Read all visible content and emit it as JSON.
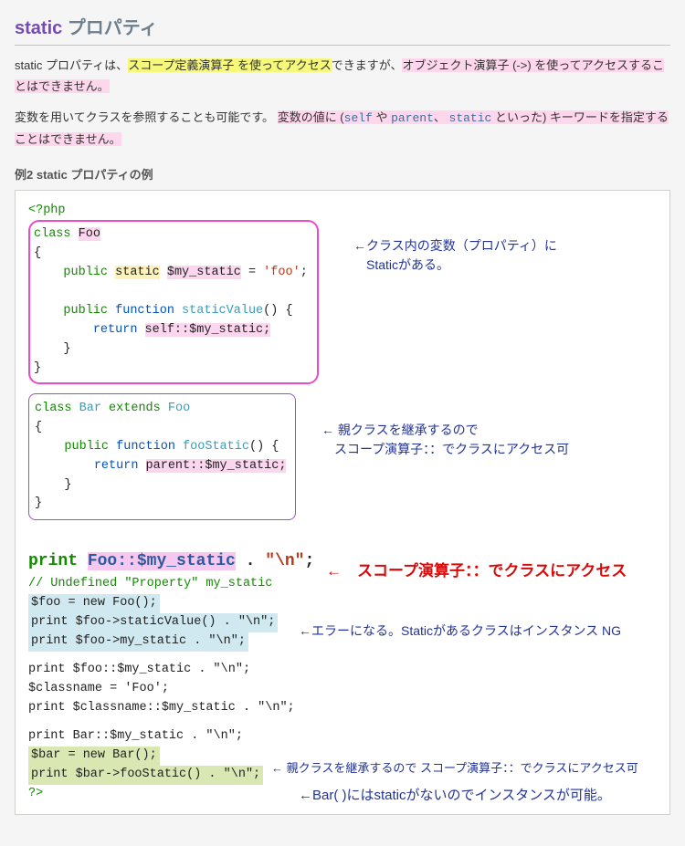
{
  "title_keyword": "static",
  "title_rest": " プロパティ",
  "para1_a": "static プロパティは、",
  "para1_hl_a": "スコープ定義演算子 を使ってアクセス",
  "para1_b": "できますが、",
  "para1_hl_b": "オブジェクト演算子 (->) を使ってアクセスすることはできません。",
  "para2_a": "変数を用いてクラスを参照することも可能です。",
  "para2_hl": "変数の値に (",
  "para2_mono1": "self",
  "para2_hl_mid1": " や ",
  "para2_mono2": "parent",
  "para2_hl_mid2": "、 ",
  "para2_mono3": "static",
  "para2_hl_tail": " といった) キーワードを指定することはできません。",
  "ex_title": "例2 static プロパティの例",
  "code_open": "<?php",
  "foo_line1": "class",
  "foo_name": "Foo",
  "foo_brace_open": "{",
  "foo_pub": "public",
  "foo_static": "static",
  "foo_var": "$my_static",
  "foo_assign": " = ",
  "foo_str": "'foo'",
  "foo_semi": ";",
  "foo_func_pub": "public",
  "foo_func_kw": "function",
  "foo_func_name": "staticValue",
  "foo_func_paren": "() {",
  "foo_return": "return",
  "foo_return_val": "self::$my_static;",
  "foo_brace_close": "}",
  "foo_brace_close2": "}",
  "bar_line1": "class",
  "bar_name": "Bar",
  "bar_ext": "extends",
  "bar_parent": "Foo",
  "bar_brace_open": "{",
  "bar_func_pub": "public",
  "bar_func_kw": "function",
  "bar_func_name": "fooStatic",
  "bar_func_paren": "() {",
  "bar_return": "return",
  "bar_return_val": "parent::$my_static;",
  "bar_brace_close": "}",
  "bar_brace_close2": "}",
  "big_print": "print",
  "big_foo": "Foo::$my_static",
  "big_cat": " . ",
  "big_nl": "\"\\n\"",
  "big_semi": ";",
  "undef_cmt": "// Undefined \"Property\" my_static",
  "undef_l1": "$foo = new Foo();",
  "undef_l2": "print $foo->staticValue() . \"\\n\";",
  "undef_l3": "print $foo->my_static . \"\\n\";",
  "midA_l1": "print $foo::$my_static . \"\\n\";",
  "midA_l2": "$classname = 'Foo';",
  "midA_l3": "print $classname::$my_static . \"\\n\";",
  "last_l1": "print Bar::$my_static . \"\\n\";",
  "last_l2": "$bar = new Bar();",
  "last_l3": "print $bar->fooStatic() . \"\\n\";",
  "close": "?>",
  "annot1_a": "←クラス内の変数（プロパティ）に",
  "annot1_b": "　Staticがある。",
  "annot2_a": "← 親クラスを継承するので",
  "annot2_b": "　スコープ演算子：：でクラスにアクセス可",
  "annot3": "←　スコープ演算子：：でクラスにアクセス",
  "annot4": "←エラーになる。Staticがあるクラスはインスタンス NG",
  "annot5": "← 親クラスを継承するので スコープ演算子：：でクラスにアクセス可",
  "annot6": "←Bar( )にはstaticがないのでインスタンスが可能。"
}
